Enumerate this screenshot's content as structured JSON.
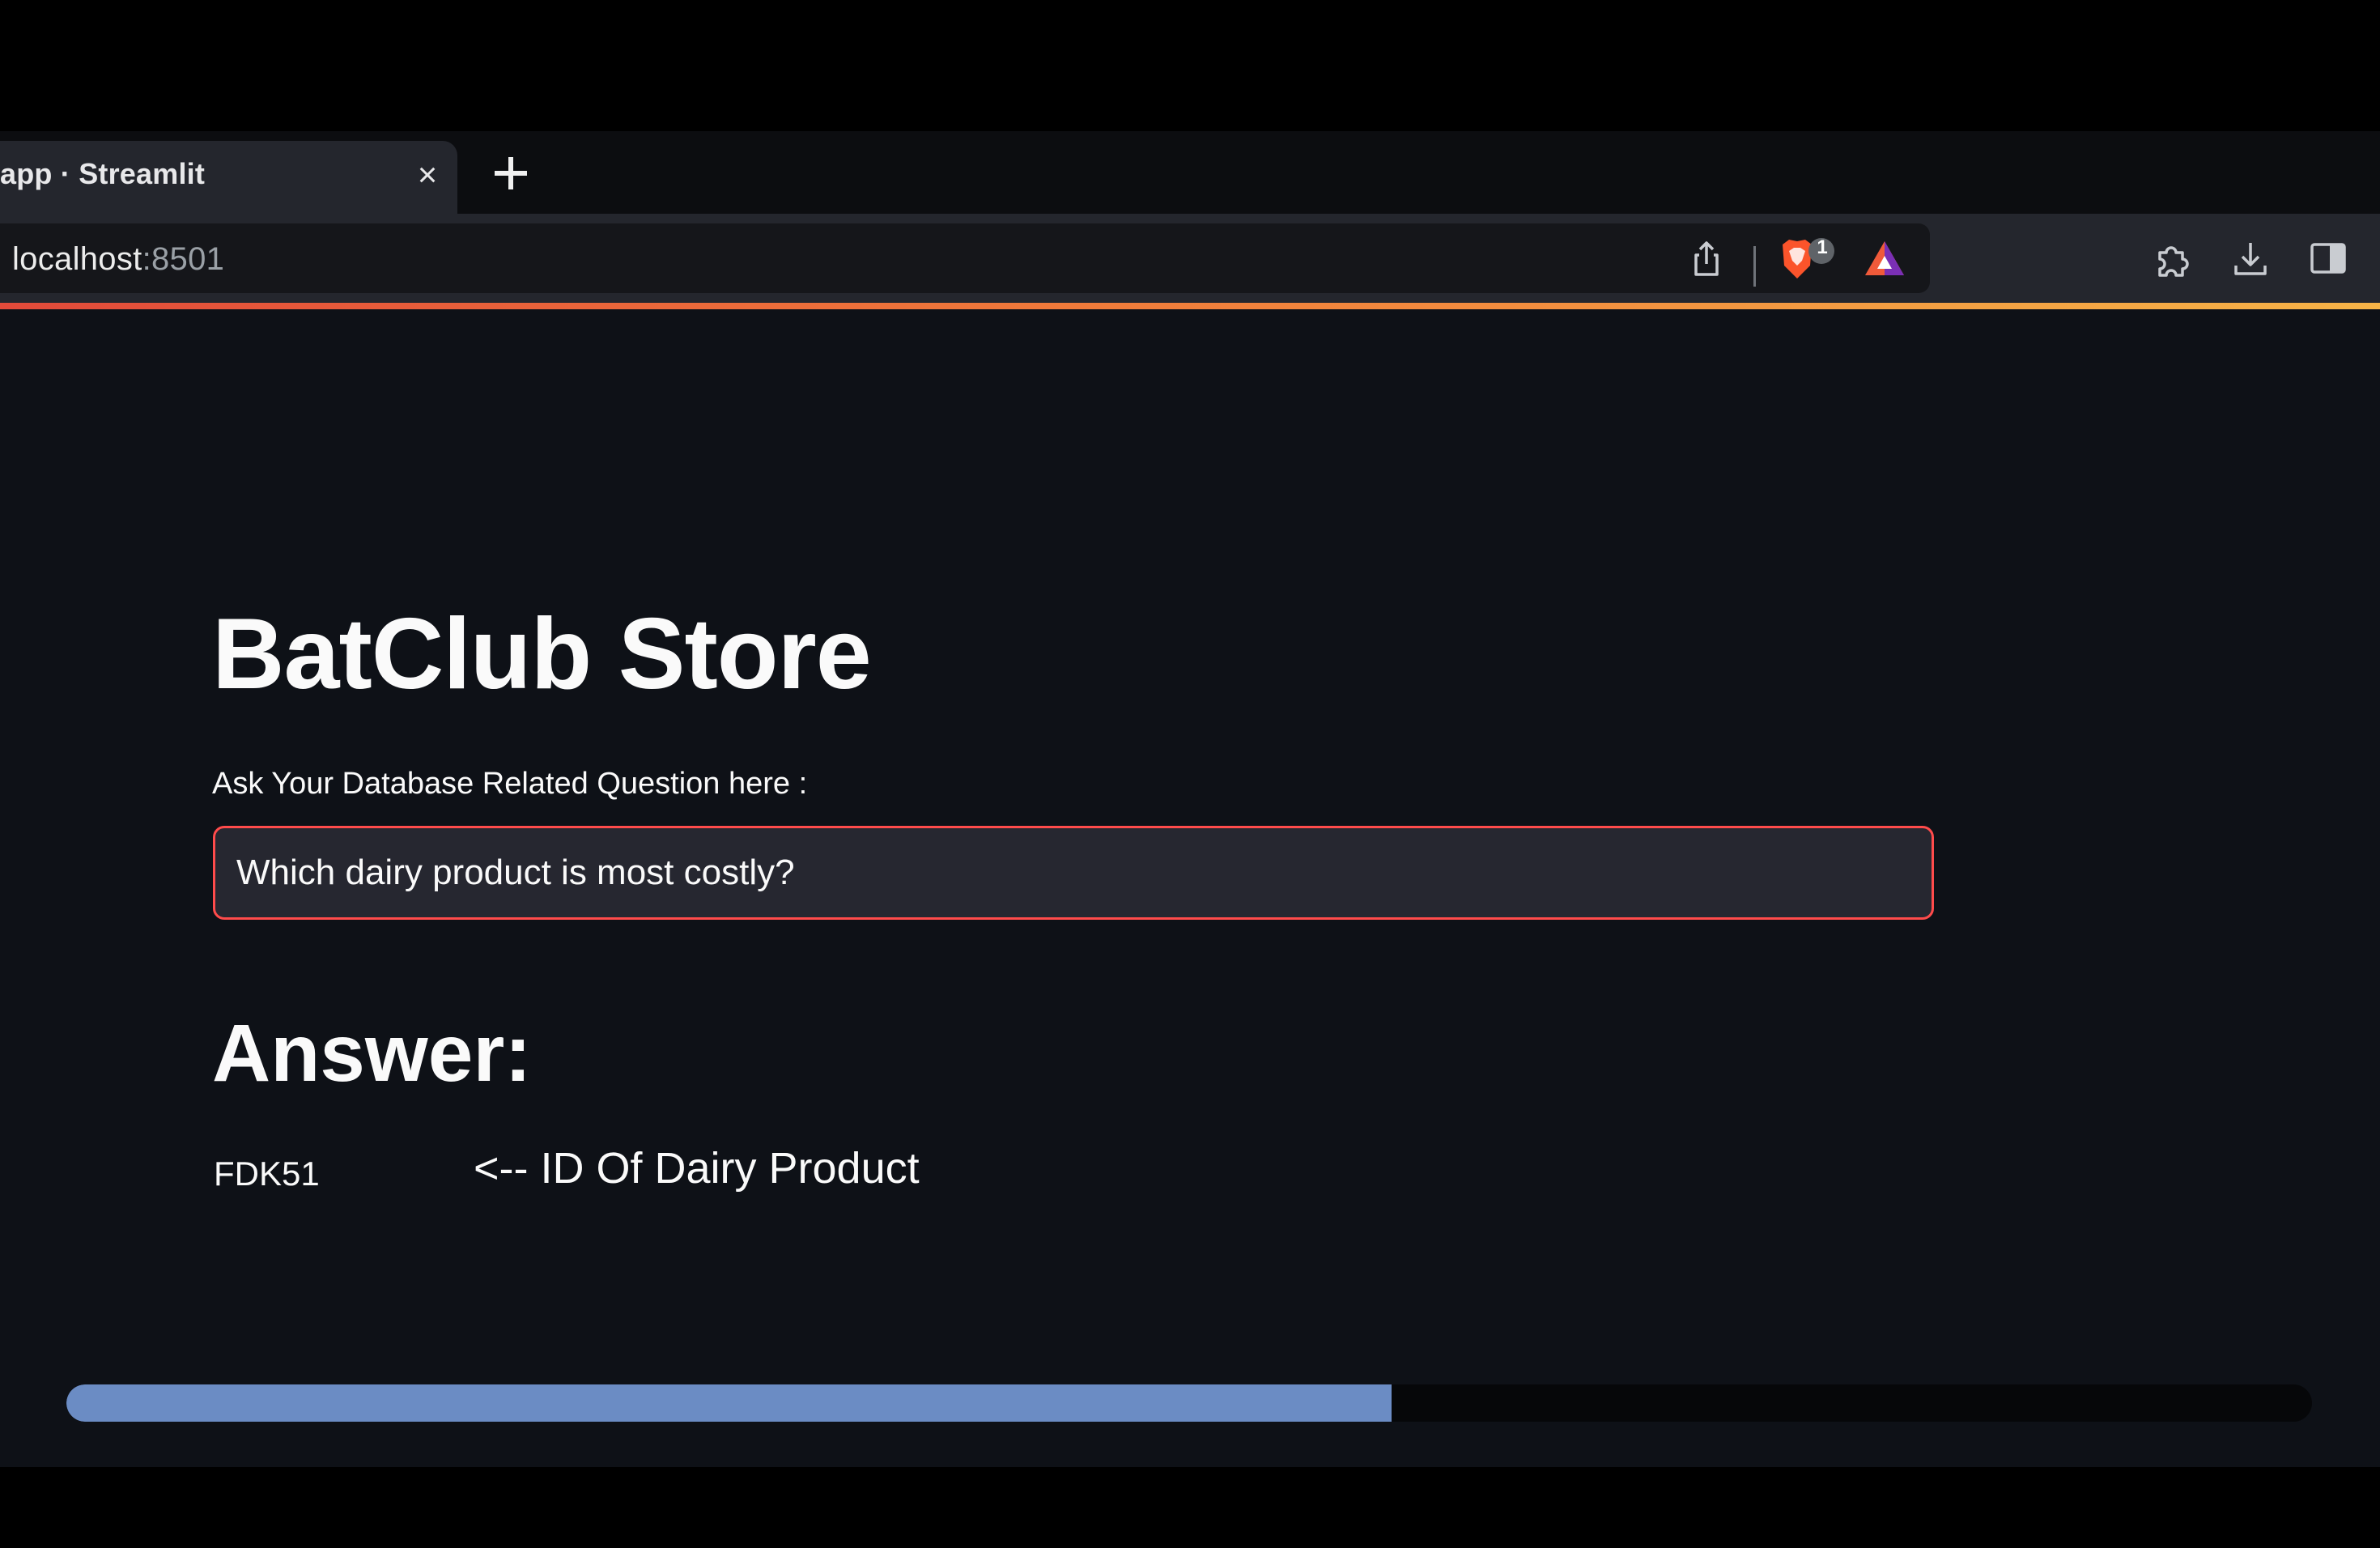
{
  "browser": {
    "tab": {
      "title": "app · Streamlit",
      "close_glyph": "×"
    },
    "new_tab_icon": "plus-icon",
    "address": {
      "host": "localhost",
      "port": ":8501"
    },
    "toolbar_icons": [
      "share-icon",
      "brave-shields-icon",
      "brave-rewards-icon",
      "extensions-icon",
      "downloads-icon",
      "sidebar-icon"
    ],
    "shields_badge": "1",
    "load_bar_colors": [
      "#e24a3a",
      "#f6b347"
    ]
  },
  "app": {
    "title": "BatClub Store",
    "input_label": "Ask Your Database Related Question here :",
    "question_value": "Which dairy product is most costly?",
    "answer_heading": "Answer:",
    "answer_value": "FDK51",
    "answer_note": "<-- ID Of Dairy Product",
    "progress_percent": 59,
    "accent_color": "#ff4b4b",
    "background_color": "#0e1117"
  }
}
